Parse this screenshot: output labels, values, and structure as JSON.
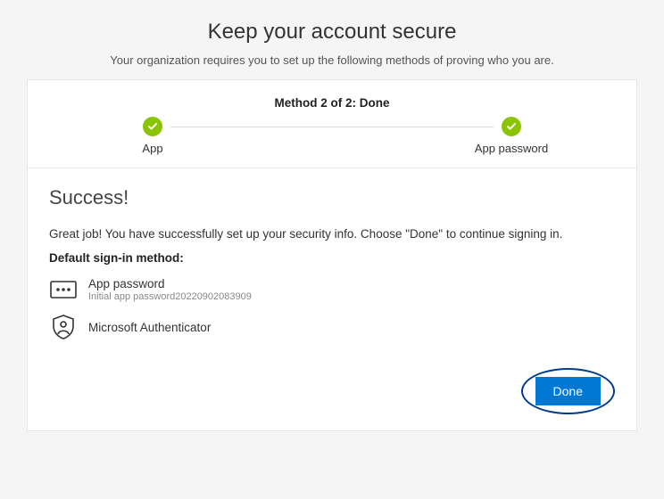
{
  "header": {
    "title": "Keep your account secure",
    "subtitle": "Your organization requires you to set up the following methods of proving who you are."
  },
  "stepper": {
    "method_text": "Method 2 of 2: Done",
    "steps": [
      {
        "label": "App",
        "done": true
      },
      {
        "label": "App password",
        "done": true
      }
    ]
  },
  "body": {
    "title": "Success!",
    "message": "Great job! You have successfully set up your security info. Choose \"Done\" to continue signing in.",
    "default_label": "Default sign-in method:",
    "methods": [
      {
        "name": "App password",
        "sub": "Initial app password20220902083909"
      },
      {
        "name": "Microsoft Authenticator",
        "sub": ""
      }
    ]
  },
  "actions": {
    "done": "Done"
  },
  "colors": {
    "primary": "#0078d4",
    "success": "#8bc400",
    "highlight_ring": "#003b8e"
  }
}
